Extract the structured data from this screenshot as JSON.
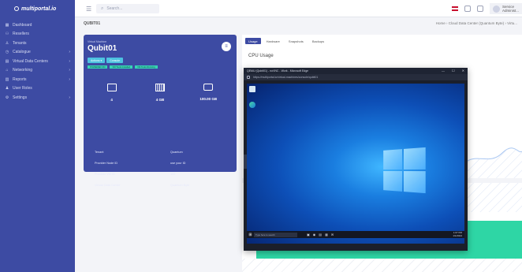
{
  "brand": {
    "name": "multiportal.io"
  },
  "sidebar": {
    "items": [
      {
        "label": "Dashboard",
        "icon": "grid-icon",
        "arrow": false
      },
      {
        "label": "Resellers",
        "icon": "users-icon",
        "arrow": false
      },
      {
        "label": "Tenants",
        "icon": "person-icon",
        "arrow": false
      },
      {
        "label": "Catalogue",
        "icon": "catalogue-icon",
        "arrow": true
      },
      {
        "label": "Virtual Data Centers",
        "icon": "server-icon",
        "arrow": true
      },
      {
        "label": "Networking",
        "icon": "network-icon",
        "arrow": true
      },
      {
        "label": "Reports",
        "icon": "report-icon",
        "arrow": true
      },
      {
        "label": "User Roles",
        "icon": "roles-icon",
        "arrow": false
      },
      {
        "label": "Settings",
        "icon": "gear-icon",
        "arrow": true
      }
    ]
  },
  "topbar": {
    "search_placeholder": "Search...",
    "user_line1": "Service",
    "user_line2": "Administ..."
  },
  "page": {
    "title": "QUBIT01",
    "breadcrumb": "Home  ›  Cloud Data Center (Quantum Byte)  ›  Virtu..."
  },
  "vm": {
    "subtitle": "Virtual Machine",
    "name": "Qubit01",
    "buttons": [
      "Actions ▾",
      "Console"
    ],
    "badges": [
      "POWERED ON",
      "VM Tools Installed",
      "VM Tools Running"
    ],
    "specs": [
      {
        "icon": "cpu-icon",
        "value": "4"
      },
      {
        "icon": "ram-icon",
        "value": "4 GB"
      },
      {
        "icon": "disk-icon",
        "value": "100.00 GB"
      }
    ],
    "info": [
      {
        "key": "Tenant",
        "value": "Quantum"
      },
      {
        "key": "Provider Node ID",
        "value": "use your ID"
      },
      {
        "key": "Provider VM ID",
        "value": "102"
      },
      {
        "key": "Virtual Data Center",
        "value": "Quantum Byte"
      }
    ]
  },
  "panel": {
    "tabs": [
      "Usage",
      "Hardware",
      "Snapshots",
      "Backups"
    ],
    "active_tab": 0,
    "cpu_title": "CPU Usage"
  },
  "console": {
    "title": "QEMU (Qubit01) - noVNC - Work - Microsoft Edge",
    "address": "https://multiportal.io/virtual-machines/console/qubit01",
    "taskbar_search": "Type here to search",
    "tray_time": "1:07 PM",
    "tray_date": "1/1/2024"
  },
  "colors": {
    "sidebar": "#3d4ba3",
    "accent_green": "#2ed6a5",
    "button_cyan": "#4dc2e0"
  }
}
